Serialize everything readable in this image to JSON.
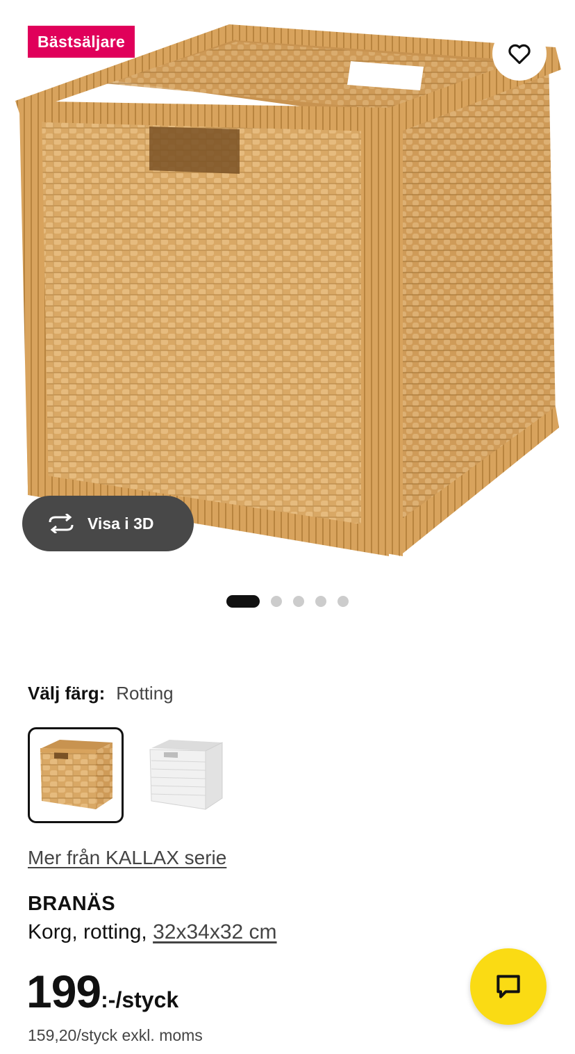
{
  "hero": {
    "badge": "Bästsäljare",
    "favorite_icon": "heart-outline-icon",
    "view_3d_label": "Visa i 3D",
    "view_3d_icon": "rotate-3d-icon",
    "carousel": {
      "total_images": 5,
      "active_index": 1
    }
  },
  "color_picker": {
    "label": "Välj färg:",
    "selected_value": "Rotting",
    "options": [
      {
        "name": "rattan-basket",
        "selected": true
      },
      {
        "name": "white-basket",
        "selected": false
      }
    ]
  },
  "series_link": "Mer från KALLAX serie",
  "product": {
    "name": "BRANÄS",
    "description": "Korg, rotting,",
    "dimensions": "32x34x32 cm"
  },
  "price": {
    "amount": "199",
    "suffix": ":-/styck",
    "excl_vat": "159,20/styck exkl. moms"
  },
  "chat_button": {
    "icon": "chat-bubble-icon"
  },
  "colors": {
    "badge": "#e0005a",
    "chat": "#fadb14",
    "pill": "#484848",
    "rattan": "#d9a865"
  }
}
